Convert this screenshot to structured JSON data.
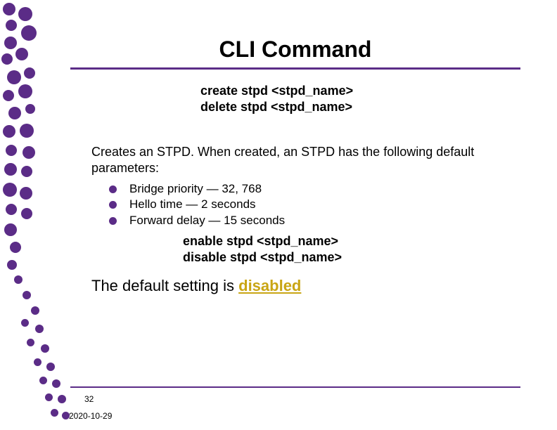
{
  "title": "CLI Command",
  "commands1": {
    "line1": "create stpd <stpd_name>",
    "line2": "delete stpd <stpd_name>"
  },
  "description": "Creates an STPD. When created, an STPD has the following default parameters:",
  "bullets": [
    "Bridge priority — 32, 768",
    "Hello time — 2 seconds",
    "Forward delay — 15 seconds"
  ],
  "commands2": {
    "line1": "enable stpd <stpd_name>",
    "line2": "disable stpd <stpd_name>"
  },
  "default_prefix": "The default setting is ",
  "default_word": "disabled",
  "page_number": "32",
  "date": "2020-10-29"
}
